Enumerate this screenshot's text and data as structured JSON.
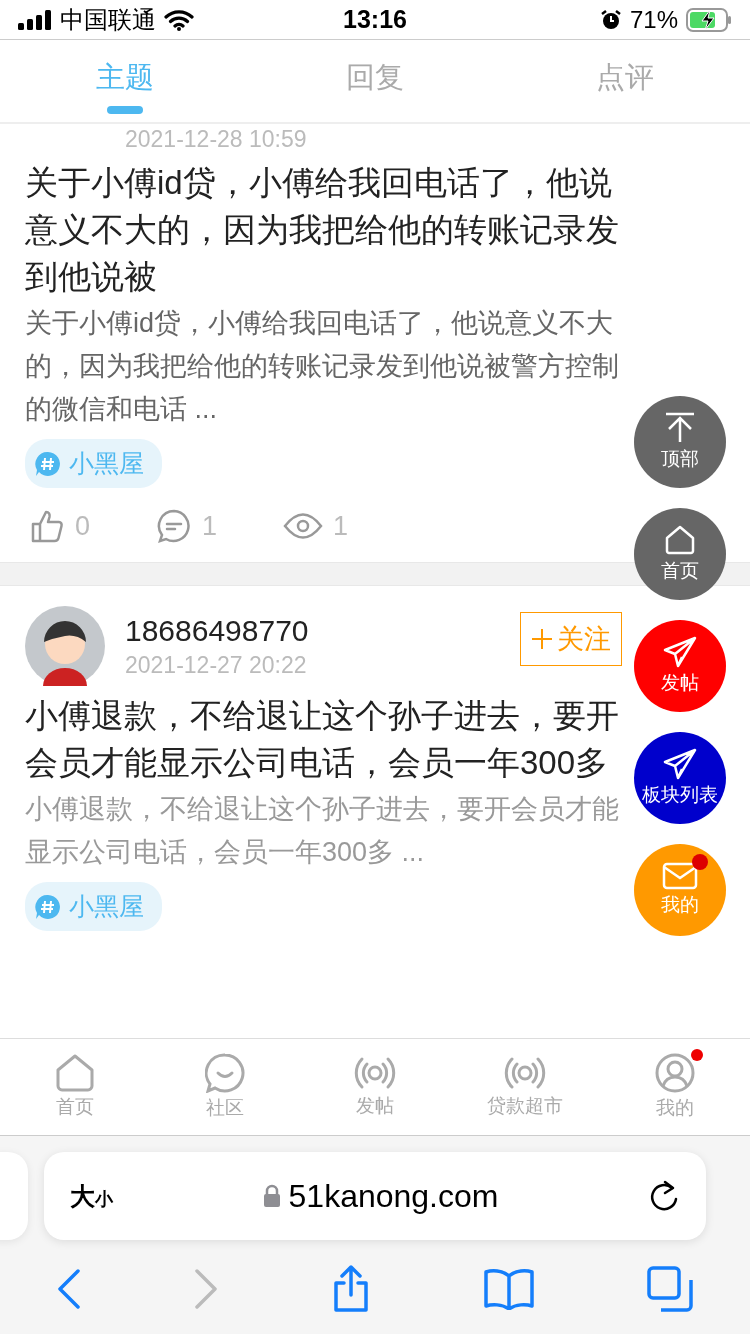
{
  "status_bar": {
    "carrier": "中国联通",
    "time": "13:16",
    "battery": "71%"
  },
  "tabs": [
    {
      "label": "主题",
      "selected": true
    },
    {
      "label": "回复",
      "selected": false
    },
    {
      "label": "点评",
      "selected": false
    }
  ],
  "posts": [
    {
      "date": "2021-12-28 10:59",
      "title": "关于小傅id贷，小傅给我回电话了，他说意义不大的，因为我把给他的转账记录发到他说被",
      "excerpt": "关于小傅id贷，小傅给我回电话了，他说意义不大的，因为我把给他的转账记录发到他说被警方控制的微信和电话 ...",
      "tag": "小黑屋",
      "stats": [
        {
          "kind": "like",
          "count": "0"
        },
        {
          "kind": "comment",
          "count": "1"
        },
        {
          "kind": "view",
          "count": "1"
        }
      ]
    },
    {
      "author": "18686498770",
      "follow": "关注",
      "date": "2021-12-27 20:22",
      "title": "小傅退款，不给退让这个孙子进去，要开会员才能显示公司电话，会员一年300多",
      "excerpt": "小傅退款，不给退让这个孙子进去，要开会员才能显示公司电话，会员一年300多 ...",
      "tag": "小黑屋"
    }
  ],
  "floating_buttons": [
    {
      "kind": "top",
      "label": "顶部",
      "color": "#666666",
      "badge": false
    },
    {
      "kind": "home",
      "label": "首页",
      "color": "#666666",
      "badge": false
    },
    {
      "kind": "post",
      "label": "发帖",
      "color": "#ff0000",
      "badge": false
    },
    {
      "kind": "boards",
      "label": "板块列表",
      "color": "#0000cc",
      "badge": false
    },
    {
      "kind": "mail",
      "label": "我的",
      "color": "#ff9900",
      "badge": true
    }
  ],
  "bottom_nav": [
    {
      "kind": "home",
      "label": "首页",
      "badge": false
    },
    {
      "kind": "chat",
      "label": "社区",
      "badge": false
    },
    {
      "kind": "signal",
      "label": "发帖",
      "badge": false
    },
    {
      "kind": "signal",
      "label": "贷款超市",
      "badge": false
    },
    {
      "kind": "user",
      "label": "我的",
      "badge": true
    }
  ],
  "browser": {
    "text_size": "大小",
    "url": "51kanong.com"
  }
}
